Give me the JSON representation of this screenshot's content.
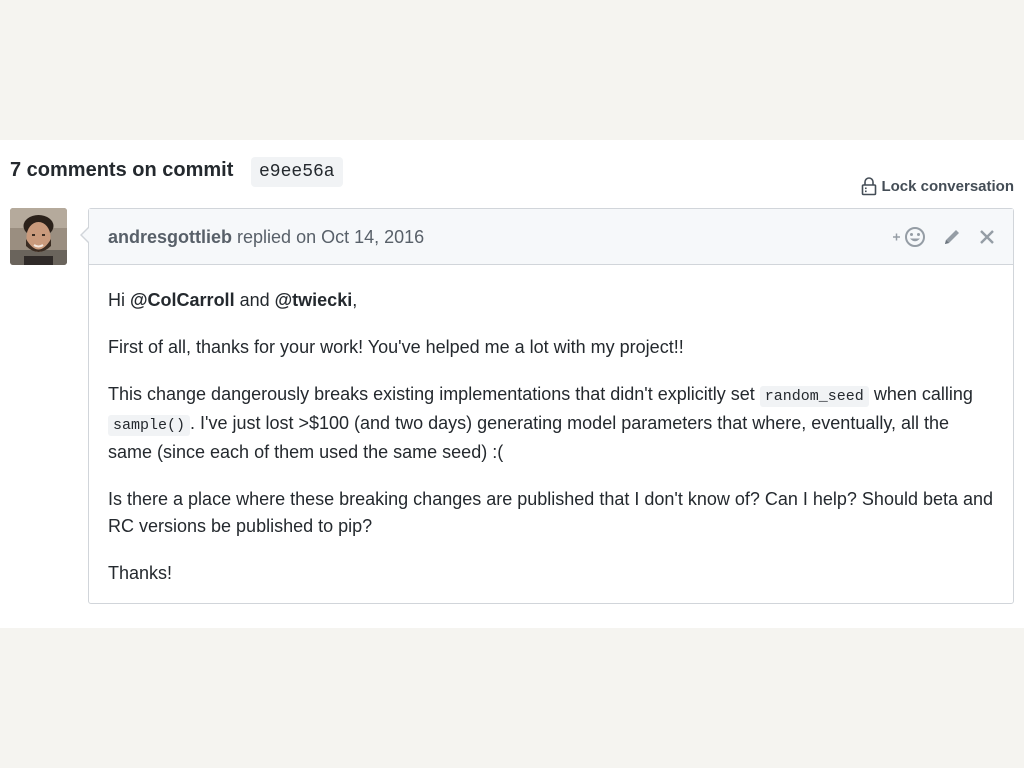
{
  "heading": {
    "text": "7 comments on commit",
    "sha": "e9ee56a"
  },
  "lock": {
    "label": "Lock conversation",
    "icon": "lock-icon"
  },
  "comment": {
    "author": "andresgottlieb",
    "replied_on": "replied on Oct 14, 2016",
    "actions": {
      "add_reaction_icon": "smiley-add-icon",
      "edit_icon": "pencil-icon",
      "delete_icon": "close-icon"
    },
    "body": {
      "p1": {
        "hi": "Hi ",
        "mention1": "@ColCarroll",
        "and": " and ",
        "mention2": "@twiecki",
        "end": ","
      },
      "p2": "First of all, thanks for your work! You've helped me a lot with my project!!",
      "p3": {
        "part1": "This change dangerously breaks existing implementations that didn't explicitly set ",
        "code1": "random_seed",
        "part2": " when calling ",
        "code2": "sample()",
        "part3": ". I've just lost >$100 (and two days) generating model parameters that where, eventually, all the same (since each of them used the same seed) :("
      },
      "p4": "Is there a place where these breaking changes are published that I don't know of? Can I help? Should beta and RC versions be published to pip?",
      "p5": "Thanks!"
    }
  }
}
